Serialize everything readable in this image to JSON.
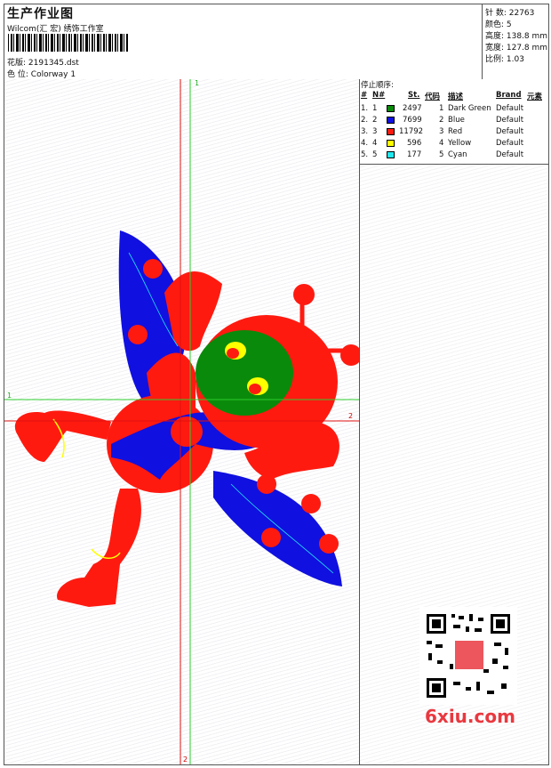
{
  "header": {
    "title": "生产作业图",
    "company": "Wilcom(汇 宏) 绣饰工作室",
    "design_label": "花版:",
    "design_file": "2191345.dst",
    "colorway_label": "色 位:",
    "colorway": "Colorway 1"
  },
  "stats": {
    "stitches": "针 数: 22763",
    "colors": "颜色: 5",
    "height": "高度: 138.8 mm",
    "width": "宽度: 127.8 mm",
    "scale": "比例: 1.03"
  },
  "stop_sequence": {
    "title": "停止顺序:",
    "headers": [
      "#",
      "N#",
      "St.",
      "代码",
      "描述",
      "Brand",
      "元素"
    ],
    "rows": [
      {
        "num": "1.",
        "n": "1",
        "color": "#0a8a0a",
        "st": "2497",
        "code": "1",
        "desc": "Dark Green",
        "brand": "Default"
      },
      {
        "num": "2.",
        "n": "2",
        "color": "#1010e0",
        "st": "7699",
        "code": "2",
        "desc": "Blue",
        "brand": "Default"
      },
      {
        "num": "3.",
        "n": "3",
        "color": "#ff1a10",
        "st": "11792",
        "code": "3",
        "desc": "Red",
        "brand": "Default"
      },
      {
        "num": "4.",
        "n": "4",
        "color": "#ffff00",
        "st": "596",
        "code": "4",
        "desc": "Yellow",
        "brand": "Default"
      },
      {
        "num": "5.",
        "n": "5",
        "color": "#22e8f0",
        "st": "177",
        "code": "5",
        "desc": "Cyan",
        "brand": "Default"
      }
    ]
  },
  "axes": {
    "green_top": "1",
    "green_left": "1",
    "red_right": "2",
    "red_bottom": "2"
  },
  "watermark": "6xiu.com",
  "colors": {
    "green": "#0a8a0a",
    "blue": "#1010e0",
    "red": "#ff1a10",
    "yellow": "#ffff00",
    "cyan": "#22e8f0",
    "axis_green": "#2ecc2e",
    "axis_red": "#e01010"
  }
}
